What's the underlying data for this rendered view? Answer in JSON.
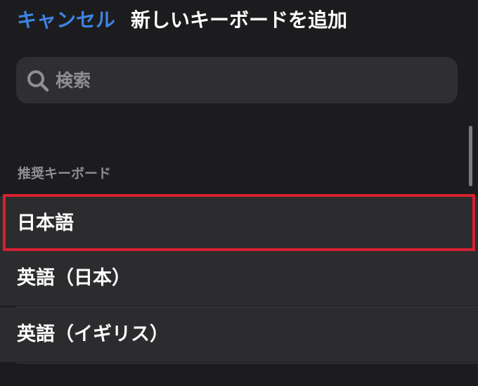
{
  "nav": {
    "cancel_label": "キャンセル",
    "title": "新しいキーボードを追加"
  },
  "search": {
    "placeholder": "検索",
    "value": "",
    "icon": "search-icon"
  },
  "sections": [
    {
      "header": "推奨キーボード",
      "items": [
        {
          "label": "日本語",
          "highlighted": true
        },
        {
          "label": "英語（日本）",
          "highlighted": false
        },
        {
          "label": "英語（イギリス）",
          "highlighted": false
        }
      ]
    }
  ],
  "colors": {
    "background": "#1c1c1e",
    "cell_background": "#2c2c2e",
    "search_background": "#2f2f32",
    "accent_blue": "#3d84e3",
    "highlight_red": "#d6202f",
    "secondary_text": "#8e8e93",
    "primary_text": "#ffffff"
  }
}
